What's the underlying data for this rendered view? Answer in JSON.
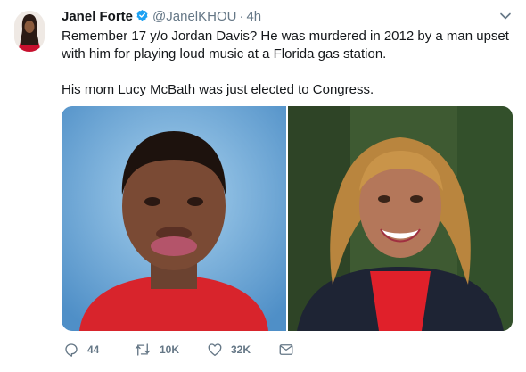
{
  "tweet": {
    "author_name": "Janel Forte",
    "author_handle": "@JanelKHOU",
    "separator": "·",
    "time": "4h",
    "text_line1": "Remember 17 y/o Jordan Davis? He was murdered in 2012 by a man upset with him for playing loud music at a Florida gas station.",
    "text_line2": "His mom Lucy McBath was just elected to Congress."
  },
  "actions": {
    "replies": "44",
    "retweets": "10K",
    "likes": "32K"
  },
  "colors": {
    "verified_blue": "#1da1f2",
    "secondary_text": "#657786"
  },
  "icons": [
    "verified-badge-icon",
    "chevron-down-icon",
    "reply-icon",
    "retweet-icon",
    "like-icon",
    "direct-message-icon"
  ]
}
